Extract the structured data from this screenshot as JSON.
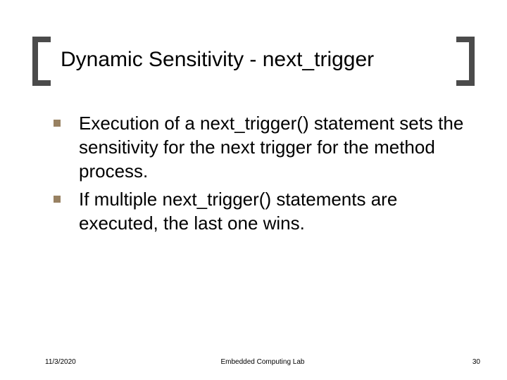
{
  "title": "Dynamic Sensitivity - next_trigger",
  "bullets": [
    "Execution of a next_trigger() statement sets the sensitivity for the next trigger for the method process.",
    "If multiple next_trigger() statements are executed, the last one wins."
  ],
  "footer": {
    "date": "11/3/2020",
    "center": "Embedded Computing Lab",
    "page": "30"
  }
}
